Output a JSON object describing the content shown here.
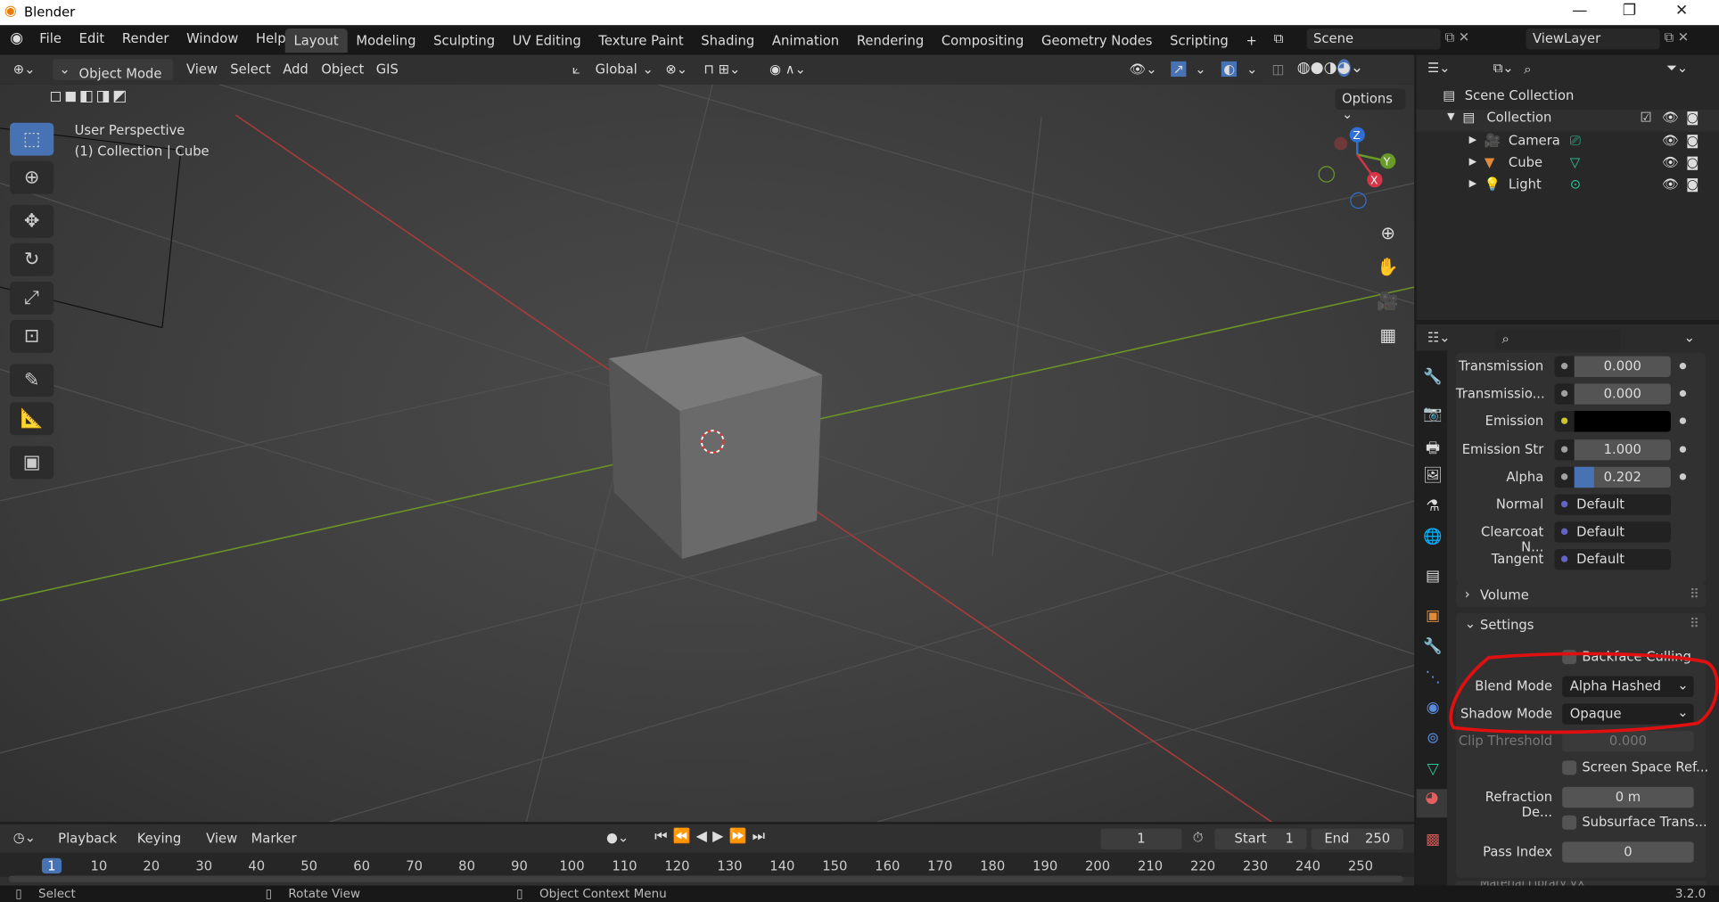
{
  "window": {
    "title": "Blender",
    "controls": [
      "—",
      "❐",
      "✕"
    ]
  },
  "menu": [
    "File",
    "Edit",
    "Render",
    "Window",
    "Help"
  ],
  "workspace_tabs": [
    {
      "label": "Layout",
      "active": true
    },
    {
      "label": "Modeling"
    },
    {
      "label": "Sculpting"
    },
    {
      "label": "UV Editing"
    },
    {
      "label": "Texture Paint"
    },
    {
      "label": "Shading"
    },
    {
      "label": "Animation"
    },
    {
      "label": "Rendering"
    },
    {
      "label": "Compositing"
    },
    {
      "label": "Geometry Nodes"
    },
    {
      "label": "Scripting"
    },
    {
      "label": "+"
    }
  ],
  "scene": "Scene",
  "view_layer": "ViewLayer",
  "viewport_header": {
    "mode": "Object Mode",
    "menus": [
      "View",
      "Select",
      "Add",
      "Object",
      "GIS"
    ],
    "transform_orientation": "Global",
    "options": "Options"
  },
  "viewport": {
    "perspective": "User Perspective",
    "context": "(1) Collection | Cube",
    "gizmo": {
      "x": "X",
      "y": "Y",
      "z": "Z"
    }
  },
  "outliner": {
    "root": "Scene Collection",
    "collection": "Collection",
    "objects": [
      "Camera",
      "Cube",
      "Light"
    ]
  },
  "properties": {
    "rows": [
      {
        "label": "Transmission",
        "value": "0.000",
        "dot": "#a0a0a0"
      },
      {
        "label": "Transmissio...",
        "value": "0.000",
        "dot": "#a0a0a0"
      },
      {
        "label": "Emission",
        "value": "",
        "dot": "#c8c82a",
        "color": "#000000"
      },
      {
        "label": "Emission Str",
        "value": "1.000",
        "dot": "#a0a0a0"
      },
      {
        "label": "Alpha",
        "value": "0.202",
        "dot": "#a0a0a0",
        "fill": 0.202
      },
      {
        "label": "Normal",
        "value": "Default",
        "dot": "#6363c7"
      },
      {
        "label": "Clearcoat N...",
        "value": "Default",
        "dot": "#6363c7"
      },
      {
        "label": "Tangent",
        "value": "Default",
        "dot": "#6363c7"
      }
    ],
    "panels": {
      "volume": "Volume",
      "settings": "Settings"
    },
    "settings": {
      "backface_culling": "Backface Culling",
      "blend_mode_label": "Blend Mode",
      "blend_mode": "Alpha Hashed",
      "shadow_mode_label": "Shadow Mode",
      "shadow_mode": "Opaque",
      "clip_label": "Clip Threshold",
      "clip": "0.000",
      "ssr": "Screen Space Ref...",
      "refraction_label": "Refraction De...",
      "refraction": "0 m",
      "subsurface": "Subsurface Trans...",
      "pass_label": "Pass Index",
      "pass": "0",
      "next_panel": "Material Library VX"
    }
  },
  "timeline": {
    "menus": [
      "Playback",
      "Keying",
      "View",
      "Marker"
    ],
    "current_frame": "1",
    "start_label": "Start",
    "start": "1",
    "end_label": "End",
    "end": "250",
    "ticks": [
      "1",
      "10",
      "20",
      "30",
      "40",
      "50",
      "60",
      "70",
      "80",
      "90",
      "100",
      "110",
      "120",
      "130",
      "140",
      "150",
      "160",
      "170",
      "180",
      "190",
      "200",
      "210",
      "220",
      "230",
      "240",
      "250"
    ]
  },
  "status": {
    "select": "Select",
    "rotate": "Rotate View",
    "context_menu": "Object Context Menu",
    "version": "3.2.0"
  },
  "colors": {
    "accent": "#4772b3",
    "annotation": "#e01010",
    "x_axis": "#b33a3a",
    "y_axis": "#6a9a2a"
  }
}
